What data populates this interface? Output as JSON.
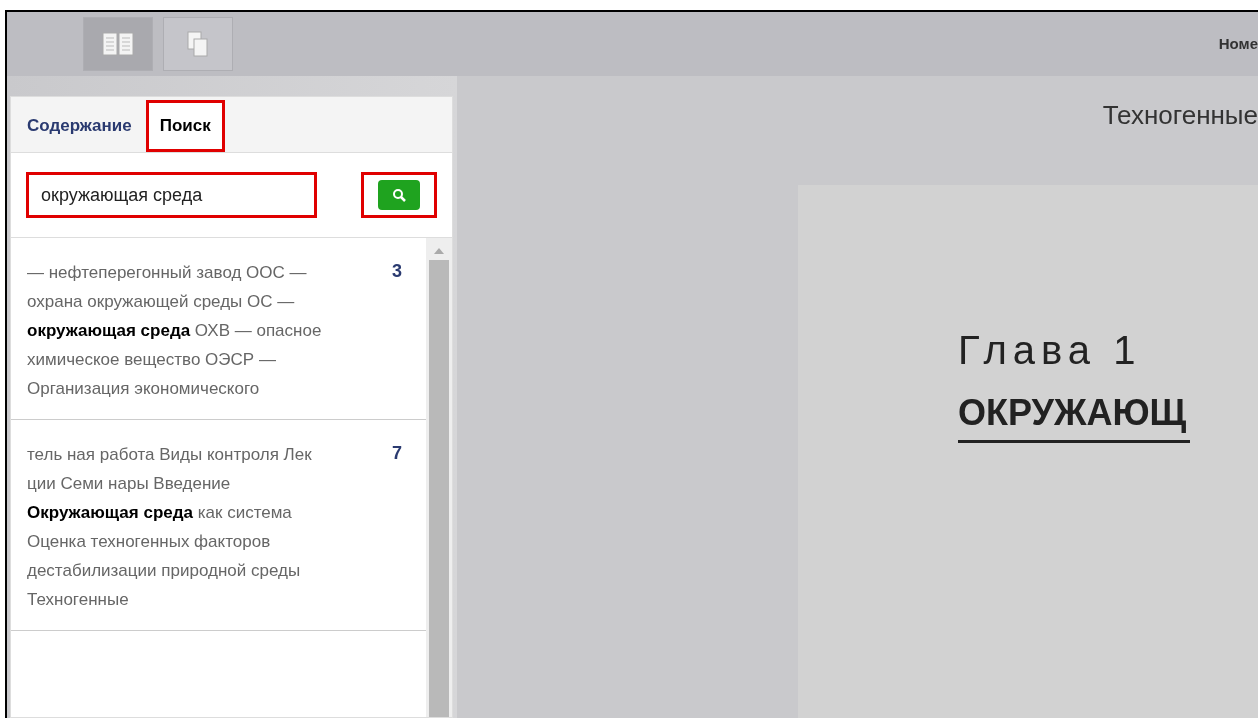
{
  "toolbar": {
    "buttons": [
      {
        "kind": "book",
        "selected": true
      },
      {
        "kind": "pages",
        "selected": false
      }
    ],
    "label": "Номе"
  },
  "sidebar": {
    "tabs": [
      {
        "label": "Содержание",
        "selected": false,
        "highlighted": false
      },
      {
        "label": "Поиск",
        "selected": true,
        "highlighted": true
      }
    ],
    "search": {
      "value": "окружающая среда",
      "highlighted": true
    },
    "search_button": {
      "highlighted": true
    },
    "results": [
      {
        "text": "— нефтеперегонный завод ООС — охрана окружающей среды ОС — **окружающая среда** ОХВ — опасное химическое вещество ОЭСР — Организация экономического",
        "page": "3"
      },
      {
        "text": "тель ная работа Виды контроля Лек ции Семи нары Введение **Окружающая среда** как система Оценка техногенных факторов дестабилизации природной среды Техногенные",
        "page": "7"
      }
    ]
  },
  "document": {
    "running_title": "Техногенные",
    "chapter": "Глава 1",
    "heading": "ОКРУЖАЮЩ"
  }
}
